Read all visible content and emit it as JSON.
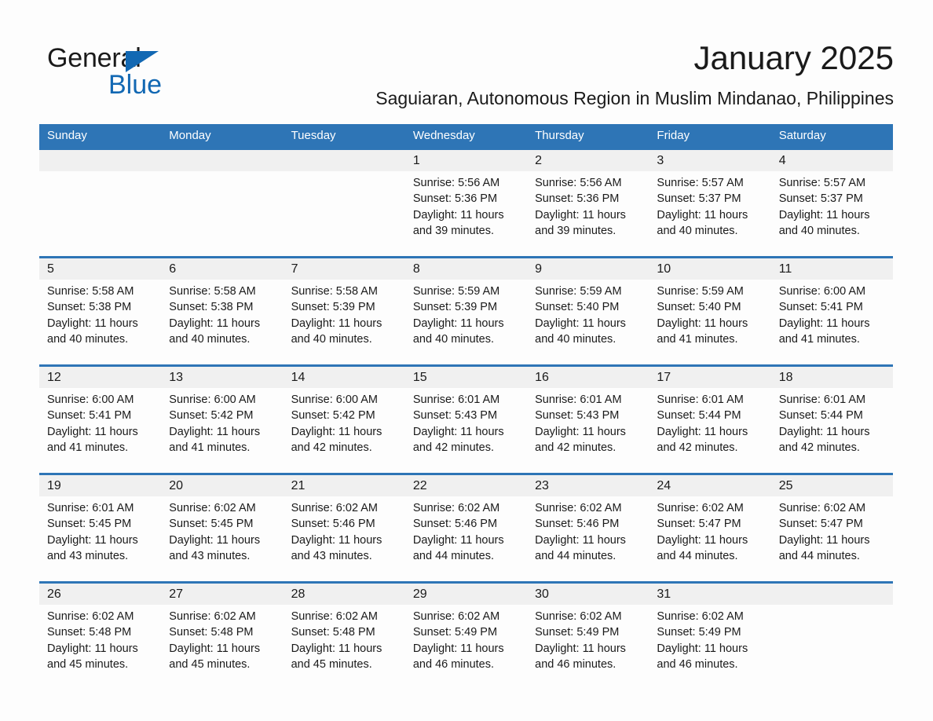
{
  "brand": {
    "name_primary": "General",
    "name_secondary": "Blue",
    "logo_color": "#1268B3"
  },
  "header": {
    "title": "January 2025",
    "subtitle": "Saguiaran, Autonomous Region in Muslim Mindanao, Philippines"
  },
  "theme": {
    "header_bg": "#2E75B6",
    "date_band_bg": "#F0F0F0",
    "page_bg": "#FDFDFD",
    "text": "#1A1A1A"
  },
  "calendar": {
    "weekday_headers": [
      "Sunday",
      "Monday",
      "Tuesday",
      "Wednesday",
      "Thursday",
      "Friday",
      "Saturday"
    ],
    "weeks": [
      [
        {
          "day": "",
          "sunrise": "",
          "sunset": "",
          "daylight": ""
        },
        {
          "day": "",
          "sunrise": "",
          "sunset": "",
          "daylight": ""
        },
        {
          "day": "",
          "sunrise": "",
          "sunset": "",
          "daylight": ""
        },
        {
          "day": "1",
          "sunrise": "Sunrise: 5:56 AM",
          "sunset": "Sunset: 5:36 PM",
          "daylight": "Daylight: 11 hours and 39 minutes."
        },
        {
          "day": "2",
          "sunrise": "Sunrise: 5:56 AM",
          "sunset": "Sunset: 5:36 PM",
          "daylight": "Daylight: 11 hours and 39 minutes."
        },
        {
          "day": "3",
          "sunrise": "Sunrise: 5:57 AM",
          "sunset": "Sunset: 5:37 PM",
          "daylight": "Daylight: 11 hours and 40 minutes."
        },
        {
          "day": "4",
          "sunrise": "Sunrise: 5:57 AM",
          "sunset": "Sunset: 5:37 PM",
          "daylight": "Daylight: 11 hours and 40 minutes."
        }
      ],
      [
        {
          "day": "5",
          "sunrise": "Sunrise: 5:58 AM",
          "sunset": "Sunset: 5:38 PM",
          "daylight": "Daylight: 11 hours and 40 minutes."
        },
        {
          "day": "6",
          "sunrise": "Sunrise: 5:58 AM",
          "sunset": "Sunset: 5:38 PM",
          "daylight": "Daylight: 11 hours and 40 minutes."
        },
        {
          "day": "7",
          "sunrise": "Sunrise: 5:58 AM",
          "sunset": "Sunset: 5:39 PM",
          "daylight": "Daylight: 11 hours and 40 minutes."
        },
        {
          "day": "8",
          "sunrise": "Sunrise: 5:59 AM",
          "sunset": "Sunset: 5:39 PM",
          "daylight": "Daylight: 11 hours and 40 minutes."
        },
        {
          "day": "9",
          "sunrise": "Sunrise: 5:59 AM",
          "sunset": "Sunset: 5:40 PM",
          "daylight": "Daylight: 11 hours and 40 minutes."
        },
        {
          "day": "10",
          "sunrise": "Sunrise: 5:59 AM",
          "sunset": "Sunset: 5:40 PM",
          "daylight": "Daylight: 11 hours and 41 minutes."
        },
        {
          "day": "11",
          "sunrise": "Sunrise: 6:00 AM",
          "sunset": "Sunset: 5:41 PM",
          "daylight": "Daylight: 11 hours and 41 minutes."
        }
      ],
      [
        {
          "day": "12",
          "sunrise": "Sunrise: 6:00 AM",
          "sunset": "Sunset: 5:41 PM",
          "daylight": "Daylight: 11 hours and 41 minutes."
        },
        {
          "day": "13",
          "sunrise": "Sunrise: 6:00 AM",
          "sunset": "Sunset: 5:42 PM",
          "daylight": "Daylight: 11 hours and 41 minutes."
        },
        {
          "day": "14",
          "sunrise": "Sunrise: 6:00 AM",
          "sunset": "Sunset: 5:42 PM",
          "daylight": "Daylight: 11 hours and 42 minutes."
        },
        {
          "day": "15",
          "sunrise": "Sunrise: 6:01 AM",
          "sunset": "Sunset: 5:43 PM",
          "daylight": "Daylight: 11 hours and 42 minutes."
        },
        {
          "day": "16",
          "sunrise": "Sunrise: 6:01 AM",
          "sunset": "Sunset: 5:43 PM",
          "daylight": "Daylight: 11 hours and 42 minutes."
        },
        {
          "day": "17",
          "sunrise": "Sunrise: 6:01 AM",
          "sunset": "Sunset: 5:44 PM",
          "daylight": "Daylight: 11 hours and 42 minutes."
        },
        {
          "day": "18",
          "sunrise": "Sunrise: 6:01 AM",
          "sunset": "Sunset: 5:44 PM",
          "daylight": "Daylight: 11 hours and 42 minutes."
        }
      ],
      [
        {
          "day": "19",
          "sunrise": "Sunrise: 6:01 AM",
          "sunset": "Sunset: 5:45 PM",
          "daylight": "Daylight: 11 hours and 43 minutes."
        },
        {
          "day": "20",
          "sunrise": "Sunrise: 6:02 AM",
          "sunset": "Sunset: 5:45 PM",
          "daylight": "Daylight: 11 hours and 43 minutes."
        },
        {
          "day": "21",
          "sunrise": "Sunrise: 6:02 AM",
          "sunset": "Sunset: 5:46 PM",
          "daylight": "Daylight: 11 hours and 43 minutes."
        },
        {
          "day": "22",
          "sunrise": "Sunrise: 6:02 AM",
          "sunset": "Sunset: 5:46 PM",
          "daylight": "Daylight: 11 hours and 44 minutes."
        },
        {
          "day": "23",
          "sunrise": "Sunrise: 6:02 AM",
          "sunset": "Sunset: 5:46 PM",
          "daylight": "Daylight: 11 hours and 44 minutes."
        },
        {
          "day": "24",
          "sunrise": "Sunrise: 6:02 AM",
          "sunset": "Sunset: 5:47 PM",
          "daylight": "Daylight: 11 hours and 44 minutes."
        },
        {
          "day": "25",
          "sunrise": "Sunrise: 6:02 AM",
          "sunset": "Sunset: 5:47 PM",
          "daylight": "Daylight: 11 hours and 44 minutes."
        }
      ],
      [
        {
          "day": "26",
          "sunrise": "Sunrise: 6:02 AM",
          "sunset": "Sunset: 5:48 PM",
          "daylight": "Daylight: 11 hours and 45 minutes."
        },
        {
          "day": "27",
          "sunrise": "Sunrise: 6:02 AM",
          "sunset": "Sunset: 5:48 PM",
          "daylight": "Daylight: 11 hours and 45 minutes."
        },
        {
          "day": "28",
          "sunrise": "Sunrise: 6:02 AM",
          "sunset": "Sunset: 5:48 PM",
          "daylight": "Daylight: 11 hours and 45 minutes."
        },
        {
          "day": "29",
          "sunrise": "Sunrise: 6:02 AM",
          "sunset": "Sunset: 5:49 PM",
          "daylight": "Daylight: 11 hours and 46 minutes."
        },
        {
          "day": "30",
          "sunrise": "Sunrise: 6:02 AM",
          "sunset": "Sunset: 5:49 PM",
          "daylight": "Daylight: 11 hours and 46 minutes."
        },
        {
          "day": "31",
          "sunrise": "Sunrise: 6:02 AM",
          "sunset": "Sunset: 5:49 PM",
          "daylight": "Daylight: 11 hours and 46 minutes."
        },
        {
          "day": "",
          "sunrise": "",
          "sunset": "",
          "daylight": ""
        }
      ]
    ]
  }
}
